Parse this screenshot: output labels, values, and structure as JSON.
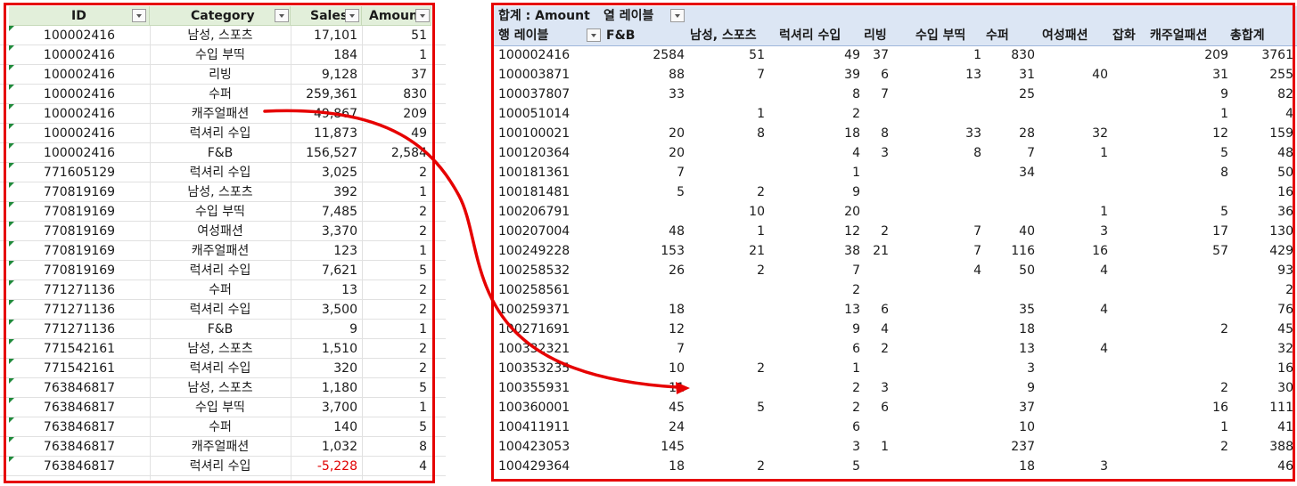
{
  "source_table": {
    "headers": [
      "ID",
      "Category",
      "Sales",
      "Amoun"
    ],
    "rows": [
      [
        "100002416",
        "남성, 스포츠",
        "17,101",
        "51"
      ],
      [
        "100002416",
        "수입 부띡",
        "184",
        "1"
      ],
      [
        "100002416",
        "리빙",
        "9,128",
        "37"
      ],
      [
        "100002416",
        "수퍼",
        "259,361",
        "830"
      ],
      [
        "100002416",
        "캐주얼패션",
        "49,867",
        "209"
      ],
      [
        "100002416",
        "럭셔리 수입",
        "11,873",
        "49"
      ],
      [
        "100002416",
        "F&B",
        "156,527",
        "2,584"
      ],
      [
        "771605129",
        "럭셔리 수입",
        "3,025",
        "2"
      ],
      [
        "770819169",
        "남성, 스포츠",
        "392",
        "1"
      ],
      [
        "770819169",
        "수입 부띡",
        "7,485",
        "2"
      ],
      [
        "770819169",
        "여성패션",
        "3,370",
        "2"
      ],
      [
        "770819169",
        "캐주얼패션",
        "123",
        "1"
      ],
      [
        "770819169",
        "럭셔리 수입",
        "7,621",
        "5"
      ],
      [
        "771271136",
        "수퍼",
        "13",
        "2"
      ],
      [
        "771271136",
        "럭셔리 수입",
        "3,500",
        "2"
      ],
      [
        "771271136",
        "F&B",
        "9",
        "1"
      ],
      [
        "771542161",
        "남성, 스포츠",
        "1,510",
        "2"
      ],
      [
        "771542161",
        "럭셔리 수입",
        "320",
        "2"
      ],
      [
        "763846817",
        "남성, 스포츠",
        "1,180",
        "5"
      ],
      [
        "763846817",
        "수입 부띡",
        "3,700",
        "1"
      ],
      [
        "763846817",
        "수퍼",
        "140",
        "5"
      ],
      [
        "763846817",
        "캐주얼패션",
        "1,032",
        "8"
      ],
      [
        "763846817",
        "럭셔리 수입",
        "-5,228",
        "4"
      ]
    ]
  },
  "pivot": {
    "value_field": "합계 : Amount",
    "column_labels": "열 레이블",
    "row_labels": "행 레이블",
    "columns": [
      "F&B",
      "남성, 스포츠",
      "럭셔리 수입",
      "리빙",
      "수입 부띡",
      "수퍼",
      "여성패션",
      "잡화",
      "캐주얼패션",
      "총합계"
    ],
    "rows": [
      [
        "100002416",
        "2584",
        "51",
        "49",
        "37",
        "1",
        "830",
        "",
        "",
        "209",
        "3761"
      ],
      [
        "100003871",
        "88",
        "7",
        "39",
        "6",
        "13",
        "31",
        "40",
        "",
        "31",
        "255"
      ],
      [
        "100037807",
        "33",
        "",
        "8",
        "7",
        "",
        "25",
        "",
        "",
        "9",
        "82"
      ],
      [
        "100051014",
        "",
        "1",
        "2",
        "",
        "",
        "",
        "",
        "",
        "1",
        "4"
      ],
      [
        "100100021",
        "20",
        "8",
        "18",
        "8",
        "33",
        "28",
        "32",
        "",
        "12",
        "159"
      ],
      [
        "100120364",
        "20",
        "",
        "4",
        "3",
        "8",
        "7",
        "1",
        "",
        "5",
        "48"
      ],
      [
        "100181361",
        "7",
        "",
        "1",
        "",
        "",
        "34",
        "",
        "",
        "8",
        "50"
      ],
      [
        "100181481",
        "5",
        "2",
        "9",
        "",
        "",
        "",
        "",
        "",
        "",
        "16"
      ],
      [
        "100206791",
        "",
        "10",
        "20",
        "",
        "",
        "",
        "1",
        "",
        "5",
        "36"
      ],
      [
        "100207004",
        "48",
        "1",
        "12",
        "2",
        "7",
        "40",
        "3",
        "",
        "17",
        "130"
      ],
      [
        "100249228",
        "153",
        "21",
        "38",
        "21",
        "7",
        "116",
        "16",
        "",
        "57",
        "429"
      ],
      [
        "100258532",
        "26",
        "2",
        "7",
        "",
        "4",
        "50",
        "4",
        "",
        "",
        "93"
      ],
      [
        "100258561",
        "",
        "",
        "2",
        "",
        "",
        "",
        "",
        "",
        "",
        "2"
      ],
      [
        "100259371",
        "18",
        "",
        "13",
        "6",
        "",
        "35",
        "4",
        "",
        "",
        "76"
      ],
      [
        "100271691",
        "12",
        "",
        "9",
        "4",
        "",
        "18",
        "",
        "",
        "2",
        "45"
      ],
      [
        "100332321",
        "7",
        "",
        "6",
        "2",
        "",
        "13",
        "4",
        "",
        "",
        "32"
      ],
      [
        "100353235",
        "10",
        "2",
        "1",
        "",
        "",
        "3",
        "",
        "",
        "",
        "16"
      ],
      [
        "100355931",
        "11",
        "",
        "2",
        "3",
        "",
        "9",
        "",
        "",
        "2",
        "30"
      ],
      [
        "100360001",
        "45",
        "5",
        "2",
        "6",
        "",
        "37",
        "",
        "",
        "16",
        "111"
      ],
      [
        "100411911",
        "24",
        "",
        "6",
        "",
        "",
        "10",
        "",
        "",
        "1",
        "41"
      ],
      [
        "100423053",
        "145",
        "",
        "3",
        "1",
        "",
        "237",
        "",
        "",
        "2",
        "388"
      ],
      [
        "100429364",
        "18",
        "2",
        "5",
        "",
        "",
        "18",
        "3",
        "",
        "",
        "46"
      ]
    ]
  },
  "colors": {
    "source_header_bg": "#e2efda",
    "pivot_header_bg": "#dce6f4",
    "highlight_red": "#e60000",
    "negative_text": "#e00000",
    "error_triangle": "#1e8a3a"
  },
  "icons": [
    "filter-dropdown-icon",
    "error-indicator-triangle",
    "arrow-connector"
  ]
}
